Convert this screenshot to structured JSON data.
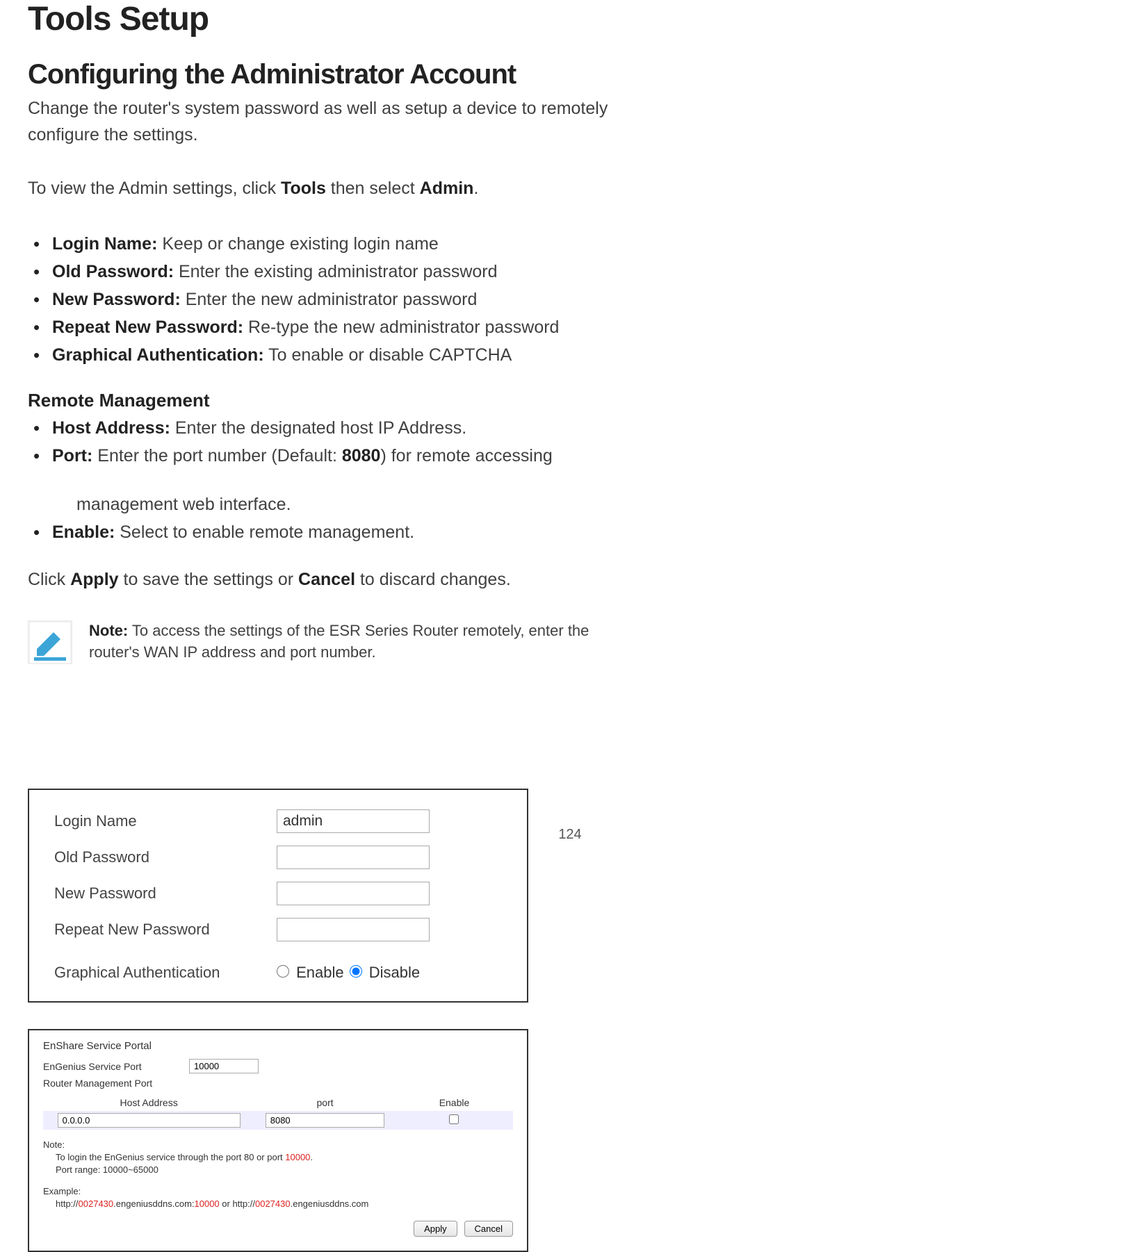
{
  "page": {
    "title": "Tools Setup",
    "section_heading": "Configuring the Administrator Account",
    "intro": "Change the router's system password as well as setup a device to remotely configure the settings.",
    "view_prefix": "To view the Admin settings, click ",
    "view_bold1": "Tools",
    "view_mid": " then select ",
    "view_bold2": "Admin",
    "view_suffix": ".",
    "page_number": "124"
  },
  "fields": {
    "login_name": {
      "label": "Login Name:",
      "desc": " Keep or change existing login name"
    },
    "old_password": {
      "label": "Old Password:",
      "desc": " Enter the existing administrator password"
    },
    "new_password": {
      "label": "New Password:",
      "desc": " Enter the new administrator password"
    },
    "repeat_password": {
      "label": "Repeat New Password:",
      "desc": " Re-type the new administrator password"
    },
    "graphical_auth": {
      "label": "Graphical Authentication:",
      "desc": " To enable or disable  CAPTCHA"
    }
  },
  "remote": {
    "heading": "Remote Management",
    "host": {
      "label": "Host Address:",
      "desc": " Enter the designated host IP Address."
    },
    "port": {
      "label": "Port:",
      "desc_pre": " Enter the port number (Default: ",
      "default": "8080",
      "desc_post": ") for remote accessing",
      "desc_line2": "management web interface."
    },
    "enable": {
      "label": "Enable:",
      "desc": " Select to enable remote management."
    }
  },
  "apply_line": {
    "pre": "Click ",
    "b1": "Apply",
    "mid": " to save the settings or ",
    "b2": "Cancel",
    "post": " to discard changes."
  },
  "note": {
    "label": "Note:",
    "text": " To access the settings of the ESR Series Router remotely, enter the router's WAN IP address and port number."
  },
  "admin_panel": {
    "login_name_label": "Login Name",
    "login_name_value": "admin",
    "old_password_label": "Old Password",
    "new_password_label": "New Password",
    "repeat_password_label": "Repeat New Password",
    "ga_label": "Graphical Authentication",
    "enable_label": "Enable",
    "disable_label": "Disable"
  },
  "service_panel": {
    "title": "EnShare Service Portal",
    "svc_port_label": "EnGenius Service Port",
    "svc_port_value": "10000",
    "router_mgmt_label": "Router Management Port",
    "cols": {
      "host": "Host Address",
      "port": "port",
      "enable": "Enable"
    },
    "host_value": "0.0.0.0",
    "port_value": "8080",
    "note_hdr": "Note:",
    "note_line1_pre": "To login the EnGenius service through the port 80 or port ",
    "note_line1_red": "10000",
    "note_line1_post": ".",
    "note_line2": "Port range: 10000~65000",
    "example_hdr": "Example:",
    "example_pre": "http://",
    "example_red1": "0027430",
    "example_mid1": ".engeniusddns.com:",
    "example_red2": "10000",
    "example_mid2": " or http://",
    "example_red3": "0027430",
    "example_post": ".engeniusddns.com",
    "apply_btn": "Apply",
    "cancel_btn": "Cancel"
  }
}
